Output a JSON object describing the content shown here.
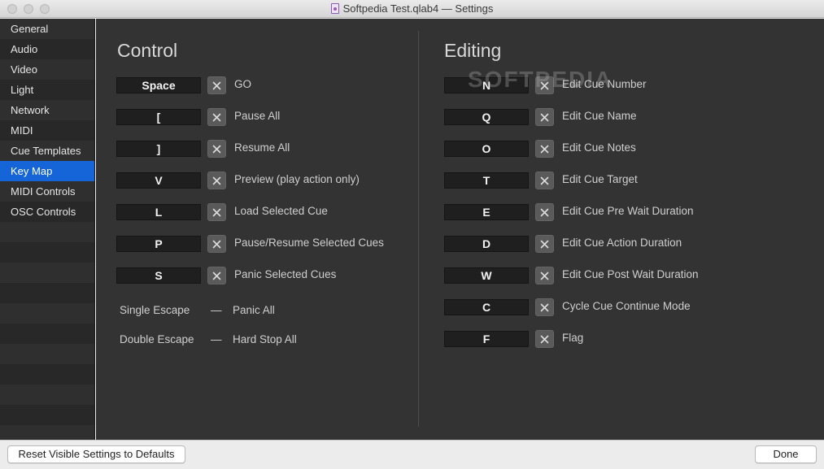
{
  "window": {
    "title": "Softpedia Test.qlab4 — Settings"
  },
  "sidebar": {
    "items": [
      {
        "label": "General"
      },
      {
        "label": "Audio"
      },
      {
        "label": "Video"
      },
      {
        "label": "Light"
      },
      {
        "label": "Network"
      },
      {
        "label": "MIDI"
      },
      {
        "label": "Cue Templates"
      },
      {
        "label": "Key Map",
        "selected": true
      },
      {
        "label": "MIDI Controls"
      },
      {
        "label": "OSC Controls"
      }
    ]
  },
  "control": {
    "heading": "Control",
    "rows": [
      {
        "key": "Space",
        "action": "GO"
      },
      {
        "key": "[",
        "action": "Pause All"
      },
      {
        "key": "]",
        "action": "Resume All"
      },
      {
        "key": "V",
        "action": "Preview (play action only)"
      },
      {
        "key": "L",
        "action": "Load Selected Cue"
      },
      {
        "key": "P",
        "action": "Pause/Resume Selected Cues"
      },
      {
        "key": "S",
        "action": "Panic Selected Cues"
      }
    ],
    "escapes": [
      {
        "key": "Single Escape",
        "dash": "—",
        "action": "Panic All"
      },
      {
        "key": "Double Escape",
        "dash": "—",
        "action": "Hard Stop All"
      }
    ]
  },
  "editing": {
    "heading": "Editing",
    "rows": [
      {
        "key": "N",
        "action": "Edit Cue Number"
      },
      {
        "key": "Q",
        "action": "Edit Cue Name"
      },
      {
        "key": "O",
        "action": "Edit Cue Notes"
      },
      {
        "key": "T",
        "action": "Edit Cue Target"
      },
      {
        "key": "E",
        "action": "Edit Cue Pre Wait Duration"
      },
      {
        "key": "D",
        "action": "Edit Cue Action Duration"
      },
      {
        "key": "W",
        "action": "Edit Cue Post Wait Duration"
      },
      {
        "key": "C",
        "action": "Cycle Cue Continue Mode"
      },
      {
        "key": "F",
        "action": "Flag"
      }
    ]
  },
  "footer": {
    "reset_label": "Reset Visible Settings to Defaults",
    "done_label": "Done"
  },
  "watermark": "SOFTPEDIA",
  "colors": {
    "accent": "#1565d8",
    "panel": "#333333",
    "sidebar": "#2b2b2b"
  },
  "icons": {
    "clear": "close-icon",
    "document": "document-icon"
  }
}
